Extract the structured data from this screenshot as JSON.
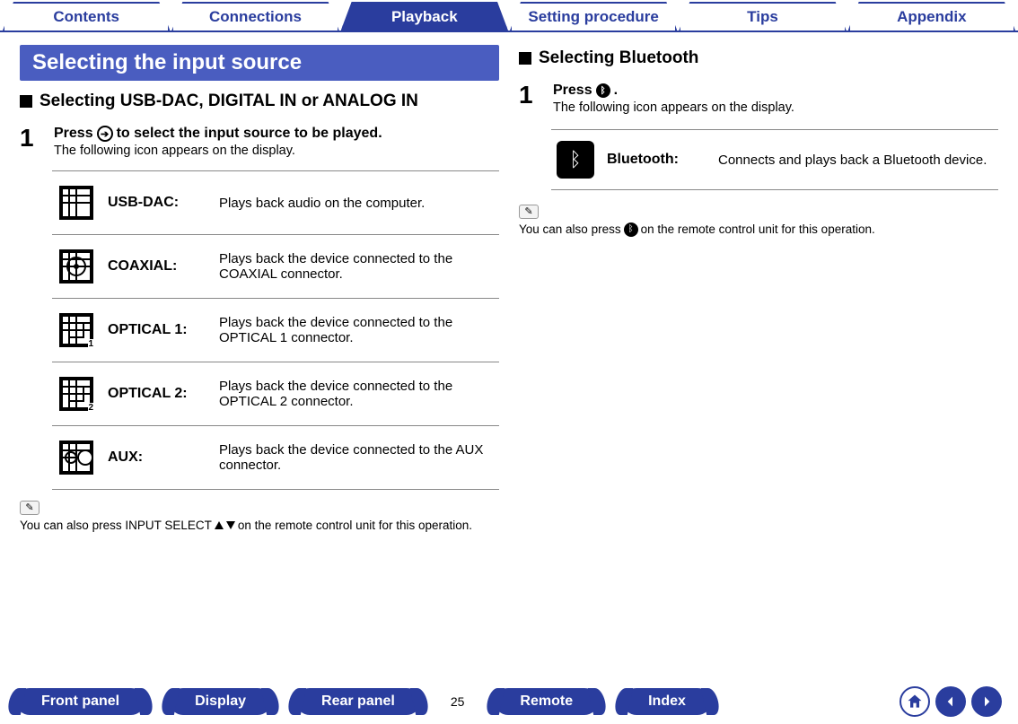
{
  "topTabs": {
    "contents": "Contents",
    "connections": "Connections",
    "playback": "Playback",
    "setting": "Setting procedure",
    "tips": "Tips",
    "appendix": "Appendix"
  },
  "left": {
    "titleBar": "Selecting the input source",
    "subHeading": "Selecting USB-DAC, DIGITAL IN or ANALOG IN",
    "step1": {
      "num": "1",
      "titleA": "Press",
      "titleB": "to select the input source to be played.",
      "desc": "The following icon appears on the display."
    },
    "sources": {
      "usbdac": {
        "label": "USB-DAC:",
        "desc": "Plays back audio on the computer."
      },
      "coax": {
        "label": "COAXIAL:",
        "desc": "Plays back the device connected to the COAXIAL connector."
      },
      "opt1": {
        "label": "OPTICAL 1:",
        "desc": "Plays back the device connected to the OPTICAL 1 connector."
      },
      "opt2": {
        "label": "OPTICAL 2:",
        "desc": "Plays back the device connected to the OPTICAL 2 connector."
      },
      "aux": {
        "label": "AUX:",
        "desc": "Plays back the device connected to the AUX connector."
      }
    },
    "noteA": "You can also press INPUT SELECT",
    "noteB": "on the remote control unit for this operation."
  },
  "right": {
    "subHeading": "Selecting Bluetooth",
    "step1": {
      "num": "1",
      "titleA": "Press",
      "titleB": ".",
      "desc": "The following icon appears on the display."
    },
    "bt": {
      "label": "Bluetooth:",
      "desc": "Connects and plays back a Bluetooth device."
    },
    "noteA": "You can also press",
    "noteB": "on the remote control unit for this operation."
  },
  "bottom": {
    "front": "Front panel",
    "display": "Display",
    "rear": "Rear panel",
    "remote": "Remote",
    "index": "Index",
    "page": "25"
  }
}
